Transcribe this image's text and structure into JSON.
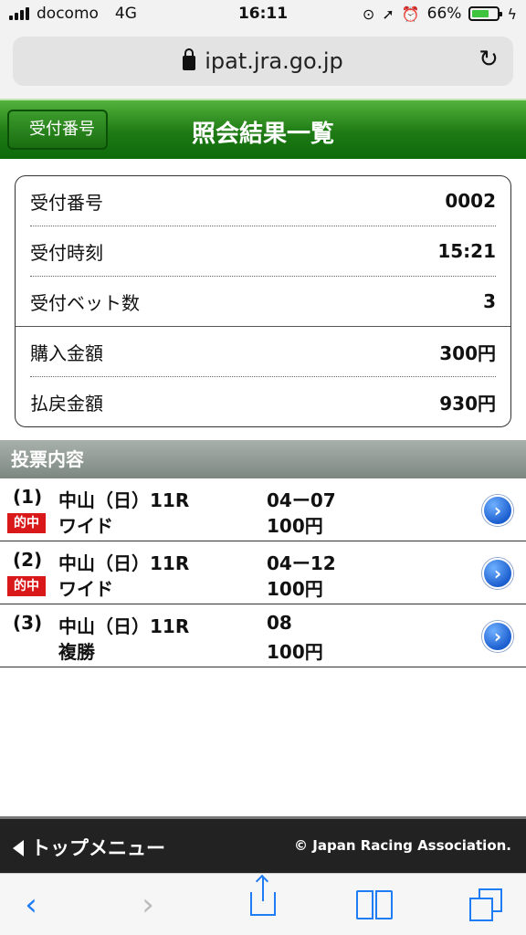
{
  "status_bar": {
    "carrier": "docomo",
    "network": "4G",
    "time": "16:11",
    "battery_percent": "66%",
    "battery_level": 0.66
  },
  "browser": {
    "host": "ipat.jra.go.jp"
  },
  "header": {
    "back_label": "受付番号",
    "title": "照会結果一覧"
  },
  "summary": [
    {
      "label": "受付番号",
      "value": "0002"
    },
    {
      "label": "受付時刻",
      "value": "15:21"
    },
    {
      "label": "受付ベット数",
      "value": "3"
    },
    {
      "label": "購入金額",
      "value": "300円"
    },
    {
      "label": "払戻金額",
      "value": "930円"
    }
  ],
  "section_title": "投票内容",
  "bets": [
    {
      "num": "(1)",
      "race": "中山（日）11R",
      "combo": "04ー07",
      "type": "ワイド",
      "amount": "100円",
      "hit": "的中"
    },
    {
      "num": "(2)",
      "race": "中山（日）11R",
      "combo": "04ー12",
      "type": "ワイド",
      "amount": "100円",
      "hit": "的中"
    },
    {
      "num": "(3)",
      "race": "中山（日）11R",
      "combo": "08",
      "type": "複勝",
      "amount": "100円",
      "hit": ""
    }
  ],
  "footer": {
    "top_menu": "トップメニュー",
    "copyright": "© Japan Racing Association."
  },
  "colors": {
    "header_green": "#1e7a14",
    "hit_red": "#d9181a",
    "link_blue": "#1e7cf5"
  },
  "toolbar_icons": [
    "back-icon",
    "forward-icon",
    "share-icon",
    "bookmarks-icon",
    "tabs-icon"
  ]
}
